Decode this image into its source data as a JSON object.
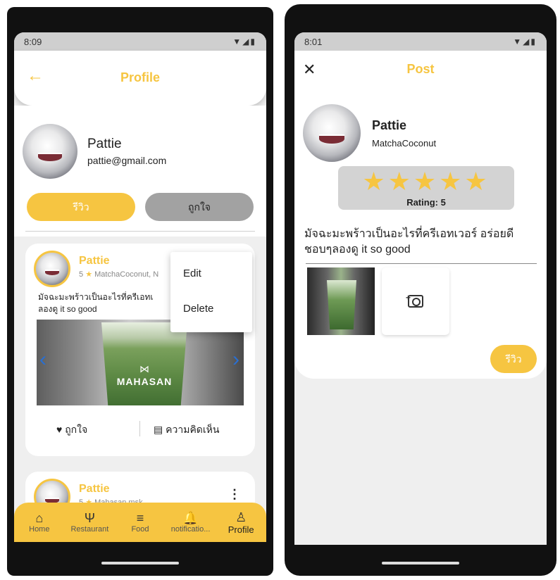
{
  "left": {
    "status": {
      "time": "8:09",
      "icons": "▼◢▮"
    },
    "appbar": {
      "title": "Profile"
    },
    "profile": {
      "name": "Pattie",
      "email": "pattie@gmail.com"
    },
    "tabs": {
      "review": "รีวิว",
      "like": "ถูกใจ"
    },
    "post1": {
      "name": "Pattie",
      "rating": "5",
      "meta": "MatchaCoconut, N",
      "text_line1": "มัจฉะมะพร้าวเป็นอะไรที่ครีเอทเ",
      "text_line2": "ลองดู it so good",
      "image_brand": "MAHASAN",
      "image_mark": "⋈",
      "like_label": "ถูกใจ",
      "comment_label": "ความคิดเห็น"
    },
    "menu": {
      "edit": "Edit",
      "delete": "Delete"
    },
    "post2": {
      "name": "Pattie",
      "rating": "5",
      "meta": "Mahasan.msk"
    },
    "nav": [
      {
        "icon": "⌂",
        "label": "Home"
      },
      {
        "icon": "Ψ",
        "label": "Restaurant"
      },
      {
        "icon": "≡",
        "label": "Food"
      },
      {
        "icon": "🔔",
        "label": "notificatio..."
      },
      {
        "icon": "♙",
        "label": "Profile"
      }
    ]
  },
  "right": {
    "status": {
      "time": "8:01",
      "icons": "▼◢▮"
    },
    "appbar": {
      "title": "Post"
    },
    "author": {
      "name": "Pattie",
      "username": "MatchaCoconut"
    },
    "rating": {
      "stars": "★★★★★",
      "label": "Rating: 5",
      "value": 5
    },
    "review_text": "มัจฉะมะพร้าวเป็นอะไรที่ครีเอทเวอร์ อร่อยดีชอบๆลองดู it so good",
    "submit_label": "รีวิว"
  },
  "colors": {
    "accent": "#f6c541",
    "grey_button": "#a2a2a2"
  }
}
